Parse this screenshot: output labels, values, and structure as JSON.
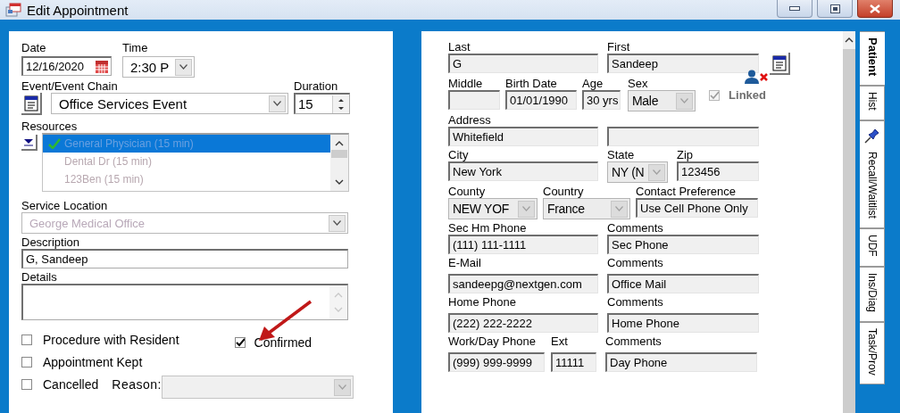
{
  "window": {
    "title": "Edit Appointment"
  },
  "appointment": {
    "date": {
      "label": "Date",
      "value": "12/16/2020"
    },
    "time": {
      "label": "Time",
      "value": "2:30 P"
    },
    "event_chain": {
      "label": "Event/Event Chain",
      "value": "Office Services Event"
    },
    "duration": {
      "label": "Duration",
      "value": "15"
    },
    "resources": {
      "label": "Resources",
      "items": [
        {
          "text": "General Physician (15 min)",
          "selected": true,
          "checked": true
        },
        {
          "text": "Dental Dr (15 min)",
          "selected": false,
          "checked": false
        },
        {
          "text": "123Ben (15 min)",
          "selected": false,
          "checked": false
        }
      ]
    },
    "service_location": {
      "label": "Service Location",
      "value": "George Medical Office"
    },
    "description": {
      "label": "Description",
      "value": "G, Sandeep"
    },
    "details": {
      "label": "Details"
    },
    "checkbox_rows": [
      {
        "checkboxes": [
          {
            "label": "Procedure with Resident",
            "checked": false
          },
          {
            "label": "Confirmed",
            "checked": true
          }
        ]
      },
      {
        "checkboxes": [
          {
            "label": "Appointment Kept",
            "checked": false
          }
        ]
      },
      {
        "checkboxes": [
          {
            "label": "Cancelled",
            "checked": false
          }
        ],
        "reason": {
          "label": "Reason:",
          "disabled": true
        }
      }
    ]
  },
  "patient": {
    "last": {
      "label": "Last",
      "value": "G"
    },
    "first": {
      "label": "First",
      "value": "Sandeep"
    },
    "middle": {
      "label": "Middle"
    },
    "birth_date": {
      "label": "Birth Date",
      "value": "01/01/1990"
    },
    "age": {
      "label": "Age",
      "value": "30 yrs"
    },
    "sex": {
      "label": "Sex",
      "value": "Male"
    },
    "linked": {
      "label": "Linked",
      "checked": true,
      "disabled": true
    },
    "address": {
      "label": "Address",
      "value": "Whitefield"
    },
    "city": {
      "label": "City",
      "value": "New York"
    },
    "state": {
      "label": "State",
      "value": "NY  (N"
    },
    "zip": {
      "label": "Zip",
      "value": "123456"
    },
    "county": {
      "label": "County",
      "value": "NEW YOF"
    },
    "country": {
      "label": "Country",
      "value": "France"
    },
    "contact_preference": {
      "label": "Contact Preference",
      "value": "Use Cell Phone Only"
    },
    "sec_hm_phone": {
      "label": "Sec Hm Phone",
      "value": "(111) 111-1111"
    },
    "sec_hm_comments": {
      "label": "Comments",
      "value": "Sec Phone"
    },
    "email": {
      "label": "E-Mail",
      "value": "sandeepg@nextgen.com"
    },
    "email_comments": {
      "label": "Comments",
      "value": "Office Mail"
    },
    "home_phone": {
      "label": "Home Phone",
      "value": "(222) 222-2222"
    },
    "home_comments": {
      "label": "Comments",
      "value": "Home Phone"
    },
    "work_phone": {
      "label": "Work/Day Phone",
      "value": "(999) 999-9999"
    },
    "ext": {
      "label": "Ext",
      "value": "11111"
    },
    "work_comments": {
      "label": "Comments",
      "value": "Day Phone"
    }
  },
  "tabs": [
    {
      "label": "Patient",
      "selected": true,
      "pin": false
    },
    {
      "label": "Hist",
      "selected": false,
      "pin": false
    },
    {
      "label": "Recall/Waitlist",
      "selected": false,
      "pin": true
    },
    {
      "label": "UDF",
      "selected": false,
      "pin": false
    },
    {
      "label": "Ins/Diag",
      "selected": false,
      "pin": false
    },
    {
      "label": "Task/Prov",
      "selected": false,
      "pin": false
    }
  ]
}
